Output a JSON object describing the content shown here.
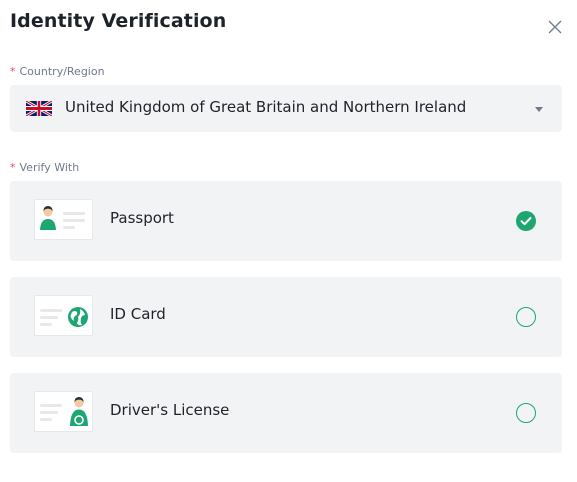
{
  "dialog": {
    "title": "Identity Verification",
    "close_icon": "close-icon"
  },
  "country": {
    "required_mark": "*",
    "label": "Country/Region",
    "value": "United Kingdom of Great Britain and Northern Ireland",
    "flag_icon": "uk-flag-icon",
    "dropdown_icon": "caret-down-icon"
  },
  "verify": {
    "required_mark": "*",
    "label": "Verify With",
    "options": [
      {
        "label": "Passport",
        "icon": "passport-icon",
        "selected": true
      },
      {
        "label": "ID Card",
        "icon": "id-card-icon",
        "selected": false
      },
      {
        "label": "Driver's License",
        "icon": "drivers-license-icon",
        "selected": false
      }
    ]
  },
  "colors": {
    "accent": "#1ea672",
    "required": "#f6465d",
    "panel_bg": "#f2f3f5",
    "text_primary": "#1e2329",
    "text_secondary": "#707a8a"
  }
}
